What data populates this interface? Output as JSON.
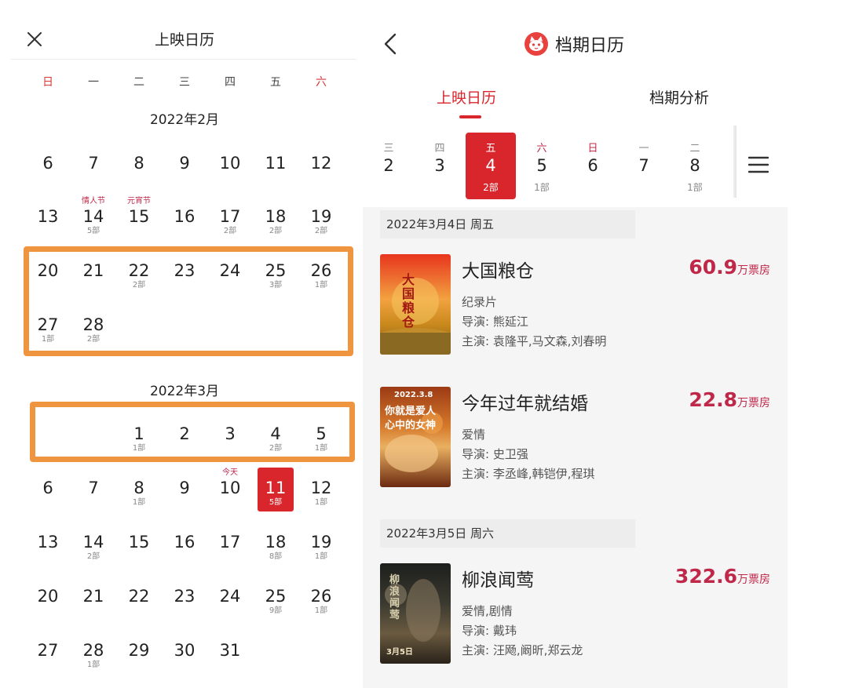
{
  "left": {
    "title": "上映日历",
    "weekdays": [
      "日",
      "一",
      "二",
      "三",
      "四",
      "五",
      "六"
    ],
    "months": [
      {
        "title": "2022年2月",
        "weeks": [
          [
            {
              "d": "6"
            },
            {
              "d": "7"
            },
            {
              "d": "8"
            },
            {
              "d": "9"
            },
            {
              "d": "10"
            },
            {
              "d": "11"
            },
            {
              "d": "12"
            }
          ],
          [
            {
              "d": "13"
            },
            {
              "d": "14",
              "fest": "情人节",
              "sub": "5部"
            },
            {
              "d": "15",
              "fest": "元宵节"
            },
            {
              "d": "16"
            },
            {
              "d": "17",
              "sub": "2部"
            },
            {
              "d": "18",
              "sub": "2部"
            },
            {
              "d": "19",
              "sub": "2部"
            }
          ],
          [
            {
              "d": "20"
            },
            {
              "d": "21"
            },
            {
              "d": "22",
              "sub": "2部"
            },
            {
              "d": "23"
            },
            {
              "d": "24"
            },
            {
              "d": "25",
              "sub": "3部"
            },
            {
              "d": "26",
              "sub": "1部"
            }
          ],
          [
            {
              "d": "27",
              "sub": "1部"
            },
            {
              "d": "28",
              "sub": "2部"
            }
          ]
        ]
      },
      {
        "title": "2022年3月",
        "weeks": [
          [
            {},
            {},
            {
              "d": "1",
              "sub": "1部"
            },
            {
              "d": "2"
            },
            {
              "d": "3"
            },
            {
              "d": "4",
              "sub": "2部"
            },
            {
              "d": "5",
              "sub": "1部"
            }
          ],
          [
            {
              "d": "6"
            },
            {
              "d": "7"
            },
            {
              "d": "8",
              "sub": "1部"
            },
            {
              "d": "9"
            },
            {
              "d": "10",
              "fest": "今天"
            },
            {
              "d": "11",
              "sub": "5部",
              "selected": true
            },
            {
              "d": "12",
              "sub": "1部"
            }
          ],
          [
            {
              "d": "13"
            },
            {
              "d": "14",
              "sub": "2部"
            },
            {
              "d": "15"
            },
            {
              "d": "16"
            },
            {
              "d": "17"
            },
            {
              "d": "18",
              "sub": "8部"
            },
            {
              "d": "19",
              "sub": "1部"
            }
          ],
          [
            {
              "d": "20"
            },
            {
              "d": "21"
            },
            {
              "d": "22"
            },
            {
              "d": "23"
            },
            {
              "d": "24"
            },
            {
              "d": "25",
              "sub": "9部"
            },
            {
              "d": "26",
              "sub": "1部"
            }
          ],
          [
            {
              "d": "27"
            },
            {
              "d": "28",
              "sub": "1部"
            },
            {
              "d": "29"
            },
            {
              "d": "30"
            },
            {
              "d": "31"
            }
          ]
        ]
      }
    ]
  },
  "right": {
    "brand_title": "档期日历",
    "tabs": [
      "上映日历",
      "档期分析"
    ],
    "strip": [
      {
        "wd": "三",
        "d": "2"
      },
      {
        "wd": "四",
        "d": "3"
      },
      {
        "wd": "五",
        "d": "4",
        "cnt": "2部",
        "active": true
      },
      {
        "wd": "六",
        "d": "5",
        "cnt": "1部",
        "red": true
      },
      {
        "wd": "日",
        "d": "6",
        "red": true
      },
      {
        "wd": "一",
        "d": "7"
      },
      {
        "wd": "二",
        "d": "8",
        "cnt": "1部"
      }
    ],
    "sections": [
      {
        "date": "2022年3月4日  周五",
        "movies": [
          {
            "title": "大国粮仓",
            "genre": "纪录片",
            "director": "导演: 熊延江",
            "cast": "主演: 袁隆平,马文森,刘春明",
            "bo": "60.9",
            "unit": "万票房"
          },
          {
            "title": "今年过年就结婚",
            "genre": "爱情",
            "director": "导演: 史卫强",
            "cast": "主演: 李丞峰,韩铠伊,程琪",
            "bo": "22.8",
            "unit": "万票房"
          }
        ]
      },
      {
        "date": "2022年3月5日  周六",
        "movies": [
          {
            "title": "柳浪闻莺",
            "genre": "爱情,剧情",
            "director": "导演: 戴玮",
            "cast": "主演: 汪飏,阚昕,郑云龙",
            "bo": "322.6",
            "unit": "万票房"
          }
        ]
      }
    ],
    "posters": {
      "p1": "大国粮仓",
      "p2_top": "2022.3.8",
      "p2_line1": "你就是爱人",
      "p2_line2": "心中的女神",
      "p3_text": "柳浪闻莺",
      "p3_date": "3月5日"
    }
  }
}
